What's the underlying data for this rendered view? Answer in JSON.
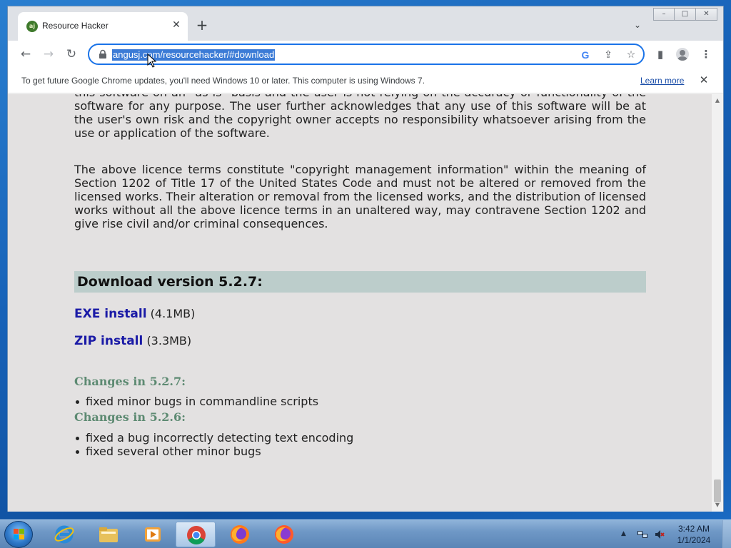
{
  "browser": {
    "tab_title": "Resource Hacker",
    "tab_favicon_text": "aj",
    "new_tab_symbol": "+",
    "url": "angusj.com/resourcehacker/#download",
    "window_controls": [
      "–",
      "□",
      "✕"
    ]
  },
  "infobar": {
    "message": "To get future Google Chrome updates, you'll need Windows 10 or later. This computer is using Windows 7.",
    "link": "Learn more"
  },
  "page": {
    "para1": "this software on an \"as is\" basis and the user is not relying on the accuracy or functionality of the software for any purpose. The user further acknowledges that any use of this software will be at the user's own risk and the copyright owner accepts no responsibility whatsoever arising from the use or application of the software.",
    "para2": "The above licence terms constitute \"copyright management information\" within the meaning of Section 1202 of Title 17 of the United States Code and must not be altered or removed from the licensed works. Their alteration or removal from the licensed works, and the distribution of licensed works without all the above licence terms in an unaltered way, may contravene Section 1202 and give rise civil and/or criminal consequences.",
    "download_header": "Download version 5.2.7:",
    "exe_link": "EXE install",
    "exe_size": "(4.1MB)",
    "zip_link": "ZIP install",
    "zip_size": "(3.3MB)",
    "changes": [
      {
        "heading": "Changes in 5.2.7:",
        "items": [
          "fixed minor bugs in commandline scripts"
        ]
      },
      {
        "heading": "Changes in 5.2.6:",
        "items": [
          "fixed a bug incorrectly detecting text encoding",
          "fixed several other minor bugs"
        ]
      }
    ]
  },
  "taskbar": {
    "time": "3:42 AM",
    "date": "1/1/2024"
  },
  "colors": {
    "download_header_bg": "#bccdcb",
    "link": "#1a1aa6",
    "changes_heading": "#5d8a72",
    "page_bg": "#e3e1e1"
  }
}
